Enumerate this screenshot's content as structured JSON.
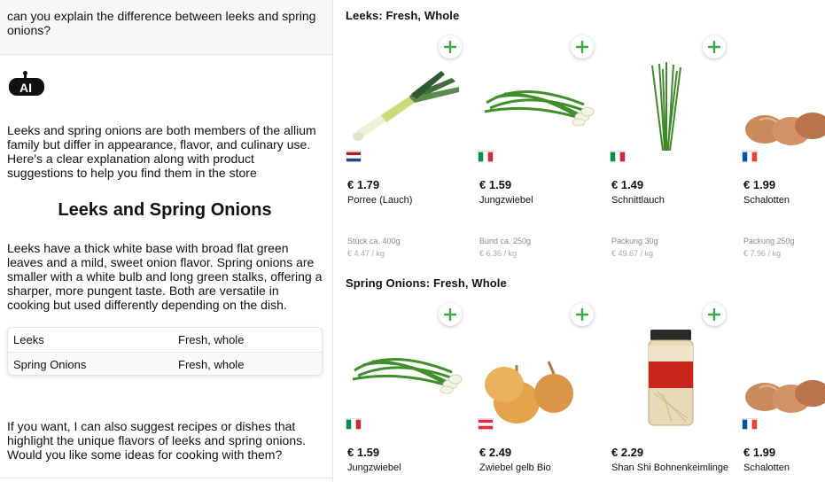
{
  "chat": {
    "user_message": "can you explain the difference between leeks and spring onions?",
    "intro": "Leeks and spring onions are both members of the allium family but differ in appearance, flavor, and culinary use. Here's a clear explanation along with product suggestions to help you find them in the store",
    "heading": "Leeks and Spring Onions",
    "body": "Leeks have a thick white base with broad flat green leaves and a mild, sweet onion flavor. Spring onions are smaller with a white bulb and long green stalks, offering a sharper, more pungent taste. Both are versatile in cooking but used differently depending on the dish.",
    "table": [
      {
        "name": "Leeks",
        "value": "Fresh, whole"
      },
      {
        "name": "Spring Onions",
        "value": "Fresh, whole"
      }
    ],
    "closing": "If you want, I can also suggest recipes or dishes that highlight the unique flavors of leeks and spring onions. Would you like some ideas for cooking with them?"
  },
  "sections": [
    {
      "title": "Leeks: Fresh, Whole",
      "products": [
        {
          "price": "€ 1.79",
          "name": "Porree (Lauch)",
          "unit": "Stück ca. 400g",
          "per_kg": "€ 4.47 / kg",
          "flag": "nl",
          "image": "leek"
        },
        {
          "price": "€ 1.59",
          "name": "Jungzwiebel",
          "unit": "Bund ca. 250g",
          "per_kg": "€ 6.36 / kg",
          "flag": "it",
          "image": "spring-onion"
        },
        {
          "price": "€ 1.49",
          "name": "Schnittlauch",
          "unit": "Packung 30g",
          "per_kg": "€ 49.67 / kg",
          "flag": "it",
          "image": "chives"
        },
        {
          "price": "€ 1.99",
          "name": "Schalotten",
          "unit": "Packung 250g",
          "per_kg": "€ 7.96 / kg",
          "flag": "fr",
          "image": "shallots"
        }
      ]
    },
    {
      "title": "Spring Onions: Fresh, Whole",
      "products": [
        {
          "price": "€ 1.59",
          "name": "Jungzwiebel",
          "flag": "it",
          "image": "spring-onion"
        },
        {
          "price": "€ 2.49",
          "name": "Zwiebel gelb Bio",
          "flag": "at",
          "image": "yellow-onion"
        },
        {
          "price": "€ 2.29",
          "name": "Shan Shi Bohnenkeimlinge",
          "image": "bean-sprout-jar"
        },
        {
          "price": "€ 1.99",
          "name": "Schalotten",
          "flag": "fr",
          "image": "shallots"
        }
      ]
    }
  ],
  "colors": {
    "accent": "#3aa845",
    "nl_red": "#ae1c28",
    "nl_blue": "#21468b",
    "it_green": "#009246",
    "it_red": "#ce2b37",
    "fr_blue": "#0055a4",
    "fr_red": "#ef4135",
    "at_red": "#ed2939"
  }
}
